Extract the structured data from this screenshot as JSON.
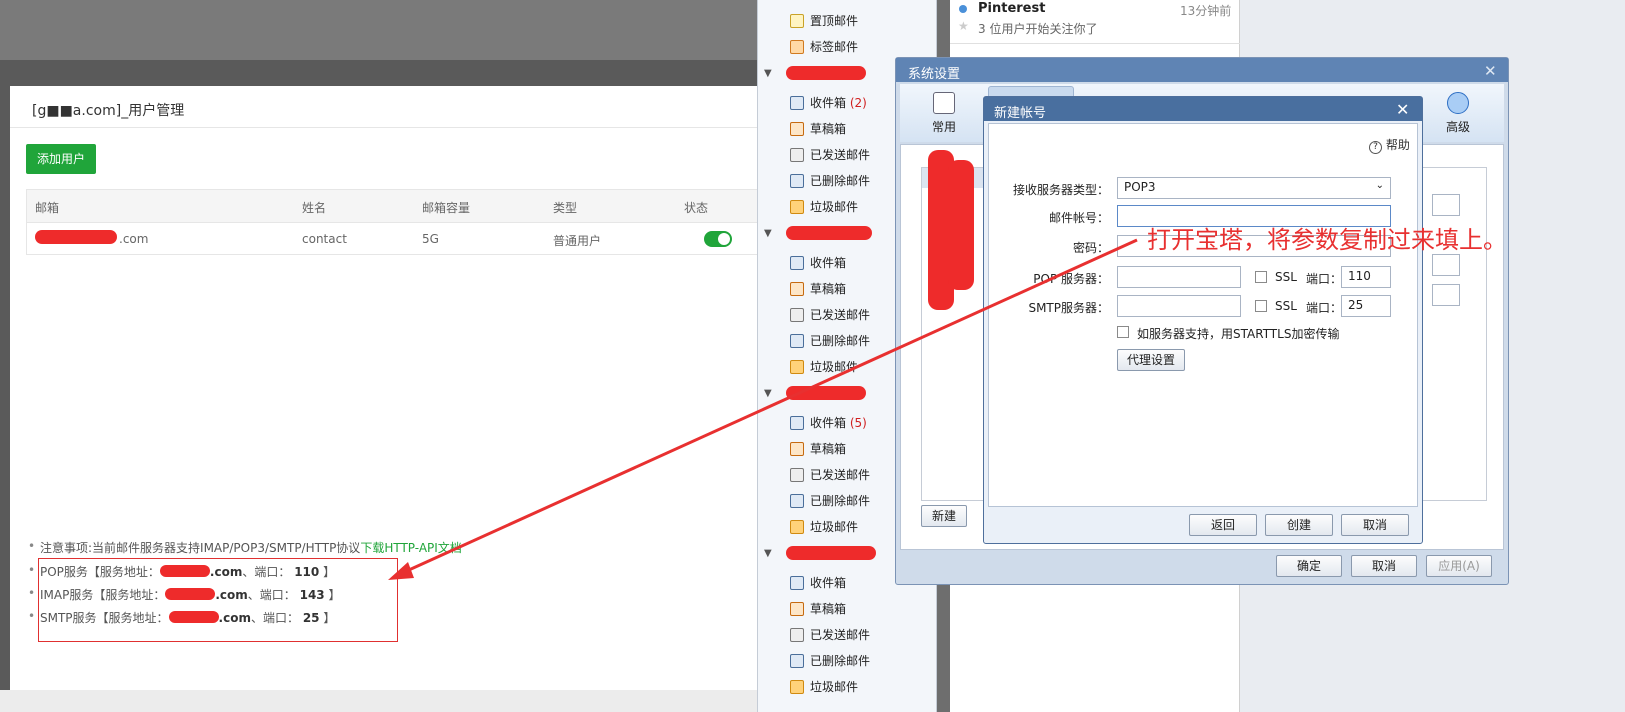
{
  "user_mgmt": {
    "title": "[g■■a.com]_用户管理",
    "add_btn": "添加用户",
    "headers": [
      "邮箱",
      "姓名",
      "邮箱容量",
      "类型",
      "状态"
    ],
    "row": {
      "email": ".com",
      "name": "contact",
      "capacity": "5G",
      "type": "普通用户",
      "enabled": true
    },
    "note": "注意事项:当前邮件服务器支持IMAP/POP3/SMTP/HTTP协议",
    "note_link": "下载HTTP-API文档",
    "services": [
      {
        "name": "POP服务【服务地址：",
        "host": ".com",
        "sep": "、端口：",
        "port": "110",
        "end": "】"
      },
      {
        "name": "IMAP服务【服务地址：",
        "host": ".com",
        "sep": "、端口：",
        "port": "143",
        "end": "】"
      },
      {
        "name": "SMTP服务【服务地址：",
        "host": ".com",
        "sep": "、端口：",
        "port": "25",
        "end": "】"
      }
    ]
  },
  "folders": {
    "pinned": "置顶邮件",
    "tagged": "标签邮件",
    "inbox": "收件箱",
    "drafts": "草稿箱",
    "sent": "已发送邮件",
    "deleted": "已删除邮件",
    "spam": "垃圾邮件",
    "inbox_counts": [
      "(2)",
      "",
      "(5)",
      ""
    ]
  },
  "message": {
    "sender": "Pinterest",
    "time": "13分钟前",
    "preview": "3 位用户开始关注你了"
  },
  "sys_settings": {
    "title": "系统设置",
    "tabs": {
      "general": "常用",
      "advanced": "高级"
    },
    "buttons": {
      "new": "新建",
      "ok": "确定",
      "cancel": "取消",
      "apply": "应用(A)"
    }
  },
  "new_account": {
    "title": "新建帐号",
    "help": "帮助",
    "server_type_label": "接收服务器类型：",
    "server_type": "POP3",
    "account_label": "邮件帐号：",
    "password_label": "密码：",
    "pop_label": "POP 服务器：",
    "smtp_label": "SMTP服务器：",
    "ssl": "SSL",
    "port_label": "端口：",
    "pop_port": "110",
    "smtp_port": "25",
    "starttls": "如服务器支持，用STARTTLS加密传输",
    "proxy": "代理设置",
    "back": "返回",
    "create": "创建",
    "cancel": "取消"
  },
  "annotation": "打开宝塔，将参数复制过来填上。",
  "colors": {
    "green": "#20a53a",
    "red": "#e83030"
  }
}
